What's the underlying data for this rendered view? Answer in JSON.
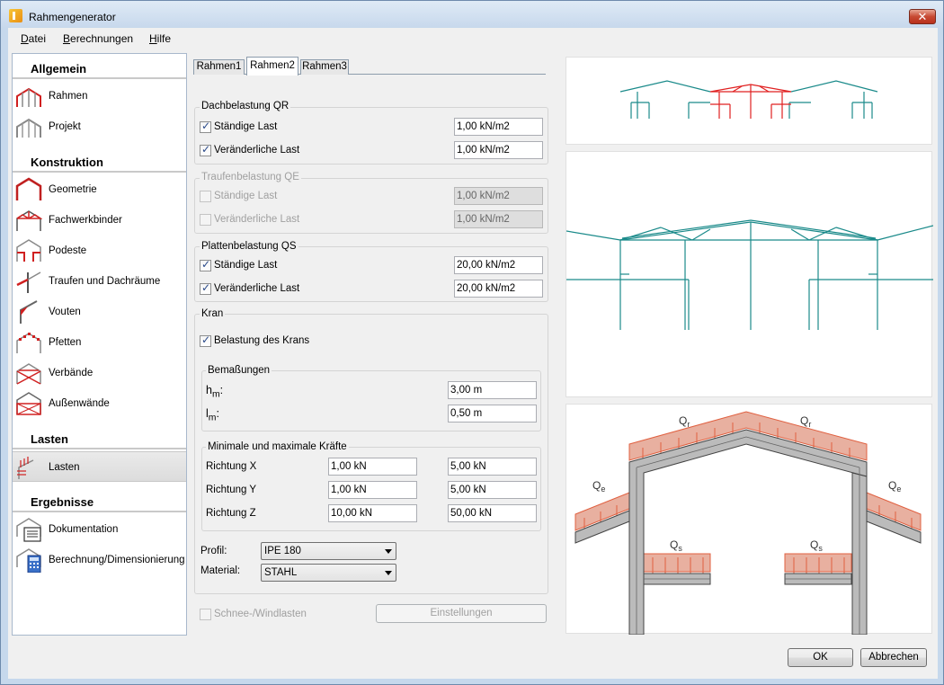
{
  "window": {
    "title": "Rahmengenerator",
    "close_glyph": "✕"
  },
  "menu": [
    {
      "first": "D",
      "rest": "atei"
    },
    {
      "first": "B",
      "rest": "erechnungen"
    },
    {
      "first": "H",
      "rest": "ilfe"
    }
  ],
  "nav": {
    "sections": [
      "Allgemein",
      "Konstruktion",
      "Lasten",
      "Ergebnisse"
    ],
    "items": [
      {
        "label": "Rahmen",
        "icon": "frame-icon"
      },
      {
        "label": "Projekt",
        "icon": "project-icon"
      },
      {
        "label": "Geometrie",
        "icon": "geometry-icon"
      },
      {
        "label": "Fachwerkbinder",
        "icon": "truss-icon"
      },
      {
        "label": "Podeste",
        "icon": "platform-icon"
      },
      {
        "label": "Traufen und Dachräume",
        "icon": "eaves-icon"
      },
      {
        "label": "Vouten",
        "icon": "haunch-icon"
      },
      {
        "label": "Pfetten",
        "icon": "purlin-icon"
      },
      {
        "label": "Verbände",
        "icon": "bracing-icon"
      },
      {
        "label": "Außenwände",
        "icon": "wall-icon"
      },
      {
        "label": "Lasten",
        "icon": "loads-icon"
      },
      {
        "label": "Dokumentation",
        "icon": "documentation-icon"
      },
      {
        "label": "Berechnung/Dimensionierung",
        "icon": "calculation-icon"
      }
    ],
    "selected": "Lasten"
  },
  "tabs": [
    "Rahmen1",
    "Rahmen2",
    "Rahmen3"
  ],
  "active_tab": "Rahmen2",
  "dach": {
    "title": "Dachbelastung QR",
    "staendig_label": "Ständige Last",
    "staendig_checked": true,
    "staendig_value": "1,00 kN/m2",
    "veraend_label": "Veränderliche Last",
    "veraend_checked": true,
    "veraend_value": "1,00 kN/m2"
  },
  "traufen": {
    "title": "Traufenbelastung QE",
    "staendig_label": "Ständige Last",
    "staendig_value": "1,00 kN/m2",
    "veraend_label": "Veränderliche Last",
    "veraend_value": "1,00 kN/m2"
  },
  "platten": {
    "title": "Plattenbelastung QS",
    "staendig_label": "Ständige Last",
    "staendig_checked": true,
    "staendig_value": "20,00 kN/m2",
    "veraend_label": "Veränderliche Last",
    "veraend_checked": true,
    "veraend_value": "20,00 kN/m2"
  },
  "kran": {
    "title": "Kran",
    "belastung_label": "Belastung des Krans",
    "belastung_checked": true,
    "bemassungen": {
      "title": "Bemaßungen",
      "hm_main": "h",
      "hm_sub": "m",
      "hm_value": "3,00 m",
      "lm_main": "l",
      "lm_sub": "m",
      "lm_value": "0,50 m"
    },
    "kraefte": {
      "title": "Minimale und maximale Kräfte",
      "rows": [
        {
          "label": "Richtung X",
          "min": "1,00 kN",
          "max": "5,00 kN"
        },
        {
          "label": "Richtung Y",
          "min": "1,00 kN",
          "max": "5,00 kN"
        },
        {
          "label": "Richtung Z",
          "min": "10,00 kN",
          "max": "50,00 kN"
        }
      ]
    },
    "profil_label": "Profil:",
    "profil_value": "IPE 180",
    "material_label": "Material:",
    "material_value": "STAHL"
  },
  "schnee_label": "Schnee-/Windlasten",
  "einstellungen_label": "Einstellungen",
  "ok_label": "OK",
  "cancel_label": "Abbrechen",
  "diagram": {
    "qr_main": "Q",
    "qr_sub": "r",
    "qe_main": "Q",
    "qe_sub": "e",
    "qs_main": "Q",
    "qs_sub": "s"
  },
  "colors": {
    "structure": "#1a8a8a",
    "highlight": "#e02020",
    "load": "#e06040",
    "load_fill": "#e8b0a0"
  }
}
